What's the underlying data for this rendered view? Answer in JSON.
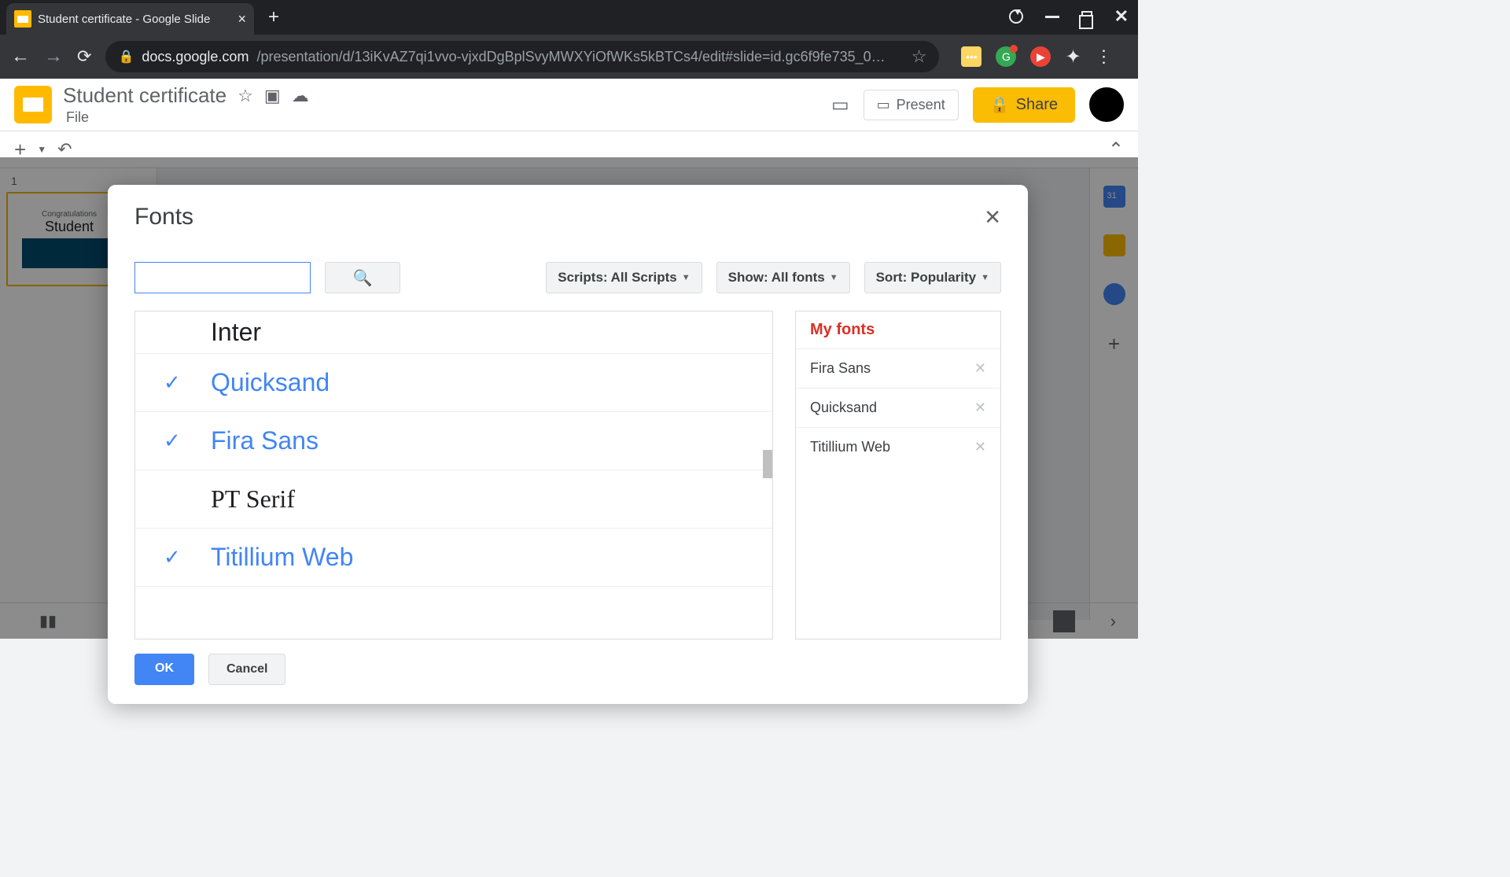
{
  "browser": {
    "tab_title": "Student certificate - Google Slide",
    "url_host": "docs.google.com",
    "url_path": "/presentation/d/13iKvAZ7qi1vvo-vjxdDgBplSvyMWXYiOfWKs5kBTCs4/edit#slide=id.gc6f9fe735_0…"
  },
  "app": {
    "doc_title": "Student certificate",
    "file_menu": "File",
    "present": "Present",
    "share": "Share",
    "slide_number": "1",
    "thumb_top": "Congratulations",
    "thumb_main": "Student"
  },
  "modal": {
    "title": "Fonts",
    "scripts_label": "Scripts: All Scripts",
    "show_label": "Show: All fonts",
    "sort_label": "Sort: Popularity",
    "my_fonts_title": "My fonts",
    "ok": "OK",
    "cancel": "Cancel",
    "fonts": [
      {
        "name": "Inter",
        "selected": false,
        "css": "sans-serif"
      },
      {
        "name": "Quicksand",
        "selected": true,
        "css": "sans-serif"
      },
      {
        "name": "Fira Sans",
        "selected": true,
        "css": "sans-serif"
      },
      {
        "name": "PT Serif",
        "selected": false,
        "css": "Georgia, serif"
      },
      {
        "name": "Titillium Web",
        "selected": true,
        "css": "sans-serif"
      }
    ],
    "my_fonts": [
      {
        "name": "Fira Sans"
      },
      {
        "name": "Quicksand"
      },
      {
        "name": "Titillium Web"
      }
    ]
  }
}
